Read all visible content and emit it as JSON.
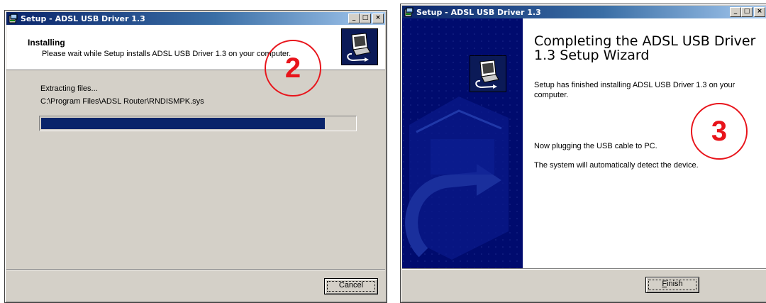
{
  "window_installing": {
    "title": "Setup - ADSL USB Driver 1.3",
    "title_buttons": [
      "_",
      "□",
      "×"
    ],
    "header_title": "Installing",
    "header_subtitle": "Please wait while Setup installs ADSL USB Driver 1.3 on your computer.",
    "status_text": "Extracting files...",
    "file_path": "C:\\Program Files\\ADSL Router\\RNDISMPK.sys",
    "progress_fraction": 0.905,
    "cancel_label": "Cancel"
  },
  "window_complete": {
    "title": "Setup - ADSL USB Driver 1.3",
    "title_buttons": [
      "_",
      "□",
      "×"
    ],
    "heading": "Completing the ADSL USB Driver 1.3 Setup Wizard",
    "finished_text": "Setup has finished installing ADSL USB Driver 1.3 on your computer.",
    "plug_text": "Now plugging the USB cable to PC.",
    "detect_text": "The system will automatically detect the device.",
    "finish_label": "Finish"
  },
  "annotations": {
    "step2": "2",
    "step3": "3"
  },
  "colors": {
    "titlebar_start": "#0a246a",
    "progress_fill": "#0a246a",
    "side_panel": "#000b6e",
    "annotation_red": "#e8141b",
    "dialog_face": "#d4d0c8"
  },
  "icons": {
    "title_icon": "setup-app-icon",
    "header_image": "computer-install-icon"
  }
}
